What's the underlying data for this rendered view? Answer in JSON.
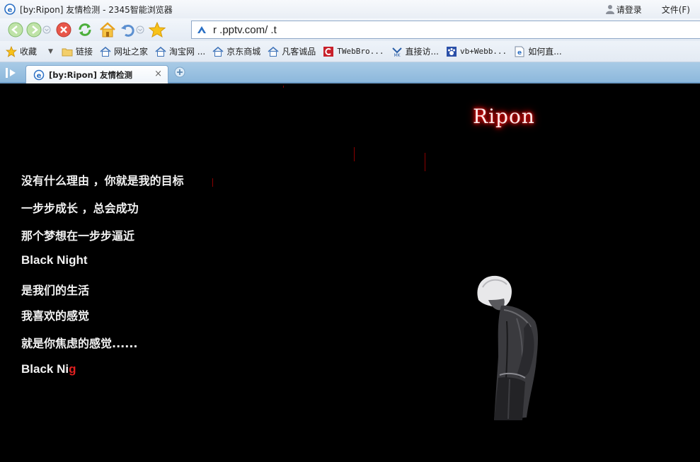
{
  "browser": {
    "window_title": "[by:Ripon] 友情检测 - 2345智能浏览器",
    "login_label": "请登录",
    "file_menu_label": "文件(F)",
    "address_url": "r              .pptv.com/          .t"
  },
  "bookmarks": {
    "favorites_label": "收藏",
    "items": [
      {
        "label": "链接",
        "icon": "folder-icon"
      },
      {
        "label": "网址之家",
        "icon": "home-icon"
      },
      {
        "label": "淘宝网 ...",
        "icon": "home-icon"
      },
      {
        "label": "京东商城",
        "icon": "home-icon"
      },
      {
        "label": "凡客诚品",
        "icon": "home-icon"
      },
      {
        "label": "TWebBro...",
        "icon": "red-c-icon"
      },
      {
        "label": "直接访...",
        "icon": "mk-icon"
      },
      {
        "label": "vb+Webb...",
        "icon": "paw-icon"
      },
      {
        "label": "如何直...",
        "icon": "ie-page-icon"
      }
    ]
  },
  "tab": {
    "title": "[by:Ripon] 友情检测",
    "close_glyph": "×"
  },
  "page": {
    "site_title": "Ripon",
    "lines": [
      "没有什么理由 ，你就是我的目标",
      "一步步成长 ，总会成功",
      "那个梦想在一步步逼近",
      "Black Night",
      "是我们的生活",
      "我喜欢的感觉",
      "就是你焦虑的感觉......"
    ],
    "typing_text": "Black Ni",
    "typing_cursor_char": "g"
  },
  "colors": {
    "page_background": "#000000",
    "text": "#f2f2f2",
    "title_glow": "#ff0000",
    "typing_cursor": "#e02020"
  }
}
